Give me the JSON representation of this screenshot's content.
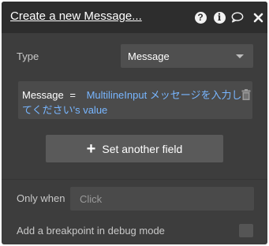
{
  "header": {
    "title": "Create a new Message...",
    "icons": [
      "help-icon",
      "info-icon",
      "comment-icon",
      "close-icon"
    ],
    "help_glyph": "?",
    "info_glyph": "i"
  },
  "type_row": {
    "label": "Type",
    "selected": "Message"
  },
  "field": {
    "name": "Message",
    "operator": "=",
    "value": "MultilineInput メッセージを入力してください's value"
  },
  "add_field_button": {
    "plus": "+",
    "label": "Set another field"
  },
  "only_when": {
    "label": "Only when",
    "placeholder": "Click"
  },
  "breakpoint": {
    "label": "Add a breakpoint in debug mode",
    "checked": false
  },
  "colors": {
    "panel": "#3d3d3d",
    "header": "#2d2d2d",
    "accent_value": "#78b6ff"
  }
}
